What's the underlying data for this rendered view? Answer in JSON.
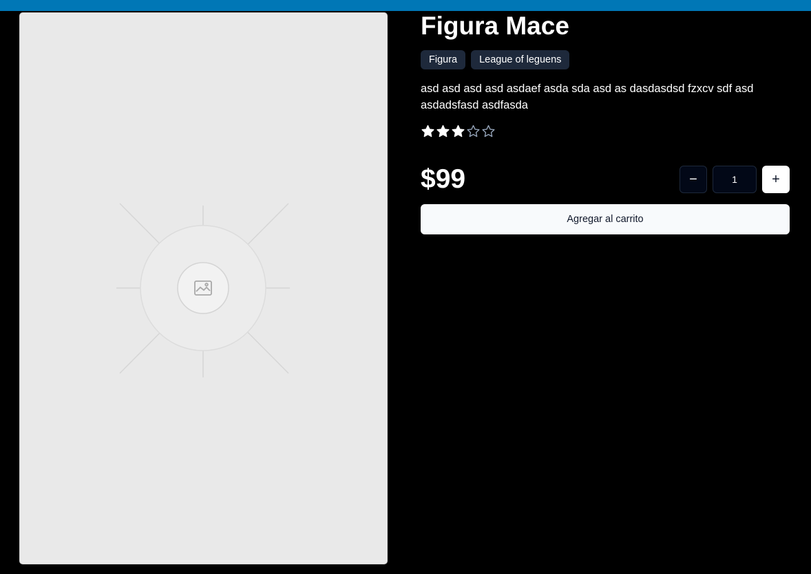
{
  "colors": {
    "top_bar": "#0077b6",
    "background": "#000000",
    "image_placeholder": "#e9e9e9",
    "tag_background": "#1e293b",
    "star_filled": "#ffffff",
    "star_empty_outline": "#94a3b8",
    "button_light": "#f8fafc"
  },
  "product": {
    "title": "Figura Mace",
    "tags": [
      "Figura",
      "League of leguens"
    ],
    "description": "asd asd asd asd asdaef asda sda asd as dasdasdsd fzxcv sdf asd asdadsfasd asdfasda",
    "rating": {
      "value": 3,
      "max": 5
    },
    "price": "$99",
    "image": {
      "icon": "image-placeholder-icon"
    }
  },
  "quantity": {
    "value": "1",
    "decrement_icon": "minus-icon",
    "increment_icon": "plus-icon",
    "decrement_symbol": "−",
    "increment_symbol": "+"
  },
  "actions": {
    "add_to_cart_label": "Agregar al carrito"
  }
}
